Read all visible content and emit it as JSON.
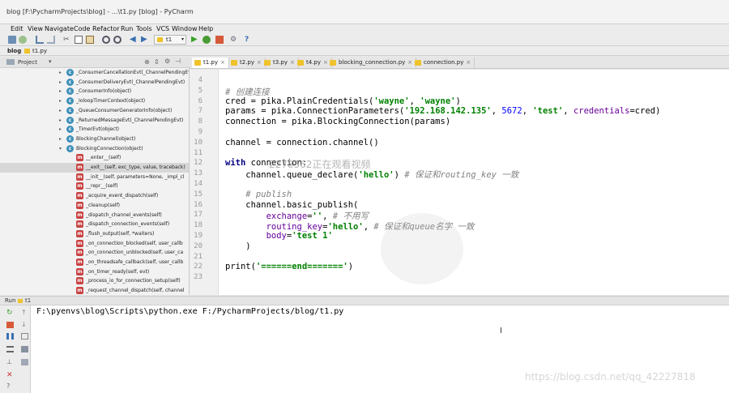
{
  "window": {
    "title": "blog [F:\\PycharmProjects\\blog] - ...\\t1.py [blog] - PyCharm"
  },
  "menu": [
    "Edit",
    "View",
    "Navigate",
    "Code",
    "Refactor",
    "Run",
    "Tools",
    "VCS",
    "Window",
    "Help"
  ],
  "toolbar": {
    "run_config": "t1"
  },
  "breadcrumb": [
    "blog",
    "t1.py"
  ],
  "project_panel": {
    "title": "Project",
    "items": [
      {
        "kind": "c",
        "label": "_ConsumerCancellationEvt(_ChannelPendingEvt)",
        "selected": false
      },
      {
        "kind": "c",
        "label": "_ConsumerDeliveryEvt(_ChannelPendingEvt)",
        "selected": false
      },
      {
        "kind": "c",
        "label": "_ConsumerInfo(object)",
        "selected": false
      },
      {
        "kind": "c",
        "label": "_IoloopTimerContext(object)",
        "selected": false
      },
      {
        "kind": "c",
        "label": "_QueueConsumerGeneratorInfo(object)",
        "selected": false
      },
      {
        "kind": "c",
        "label": "_ReturnedMessageEvt(_ChannelPendingEvt)",
        "selected": false
      },
      {
        "kind": "c",
        "label": "_TimerEvt(object)",
        "selected": false
      },
      {
        "kind": "c",
        "label": "BlockingChannel(object)",
        "selected": false
      },
      {
        "kind": "c",
        "label": "BlockingConnection(object)",
        "selected": false
      },
      {
        "kind": "m",
        "label": "__enter__(self)",
        "selected": false
      },
      {
        "kind": "m",
        "label": "__exit__(self, exc_type, value, traceback)",
        "selected": true
      },
      {
        "kind": "m",
        "label": "__init__(self, parameters=None, _impl_cl",
        "selected": false
      },
      {
        "kind": "m",
        "label": "__repr__(self)",
        "selected": false
      },
      {
        "kind": "m",
        "label": "_acquire_event_dispatch(self)",
        "selected": false
      },
      {
        "kind": "m",
        "label": "_cleanup(self)",
        "selected": false
      },
      {
        "kind": "m",
        "label": "_dispatch_channel_events(self)",
        "selected": false
      },
      {
        "kind": "m",
        "label": "_dispatch_connection_events(self)",
        "selected": false
      },
      {
        "kind": "m",
        "label": "_flush_output(self, *waiters)",
        "selected": false
      },
      {
        "kind": "m",
        "label": "_on_connection_blocked(self, user_callb",
        "selected": false
      },
      {
        "kind": "m",
        "label": "_on_connection_unblocked(self, user_ca",
        "selected": false
      },
      {
        "kind": "m",
        "label": "_on_threadsafe_callback(self, user_callb",
        "selected": false
      },
      {
        "kind": "m",
        "label": "_on_timer_ready(self, evt)",
        "selected": false
      },
      {
        "kind": "m",
        "label": "_process_io_for_connection_setup(self)",
        "selected": false
      },
      {
        "kind": "m",
        "label": "_request_channel_dispatch(self, channel",
        "selected": false
      }
    ]
  },
  "tabs": [
    {
      "label": "t1.py",
      "active": true
    },
    {
      "label": "t2.py",
      "active": false
    },
    {
      "label": "t3.py",
      "active": false
    },
    {
      "label": "t4.py",
      "active": false
    },
    {
      "label": "blocking_connection.py",
      "active": false
    },
    {
      "label": "connection.py",
      "active": false
    }
  ],
  "editor": {
    "line_numbers": [
      "4",
      "5",
      "6",
      "7",
      "8",
      "9",
      "10",
      "11",
      "12",
      "13",
      "14",
      "15",
      "16",
      "17",
      "18",
      "19",
      "20",
      "21",
      "22",
      "23"
    ],
    "lines": [
      [],
      [
        {
          "c": "cm",
          "t": "# 创建连接"
        }
      ],
      [
        {
          "c": "",
          "t": "cred = pika.PlainCredentials("
        },
        {
          "c": "str",
          "t": "'wayne'"
        },
        {
          "c": "",
          "t": ", "
        },
        {
          "c": "str",
          "t": "'wayne'"
        },
        {
          "c": "",
          "t": ")"
        }
      ],
      [
        {
          "c": "",
          "t": "params = pika.ConnectionParameters("
        },
        {
          "c": "str",
          "t": "'192.168.142.135'"
        },
        {
          "c": "",
          "t": ", "
        },
        {
          "c": "num",
          "t": "5672"
        },
        {
          "c": "",
          "t": ", "
        },
        {
          "c": "str",
          "t": "'test'"
        },
        {
          "c": "",
          "t": ", "
        },
        {
          "c": "kwa",
          "t": "credentials"
        },
        {
          "c": "",
          "t": "=cred)"
        }
      ],
      [
        {
          "c": "",
          "t": "connection = pika.BlockingConnection(params)"
        }
      ],
      [],
      [
        {
          "c": "",
          "t": "channel = connection.channel()"
        }
      ],
      [],
      [
        {
          "c": "kw",
          "t": "with"
        },
        {
          "c": "",
          "t": " connection:"
        }
      ],
      [
        {
          "c": "",
          "t": "    channel.queue_declare("
        },
        {
          "c": "str",
          "t": "'hello'"
        },
        {
          "c": "",
          "t": ") "
        },
        {
          "c": "cm",
          "t": "# 保证和routing_key 一致"
        }
      ],
      [],
      [
        {
          "c": "cm",
          "t": "    # publish"
        }
      ],
      [
        {
          "c": "",
          "t": "    channel.basic_publish("
        }
      ],
      [
        {
          "c": "kwa",
          "t": "        exchange"
        },
        {
          "c": "",
          "t": "="
        },
        {
          "c": "str",
          "t": "''"
        },
        {
          "c": "",
          "t": ", "
        },
        {
          "c": "cm",
          "t": "# 不用写"
        }
      ],
      [
        {
          "c": "kwa",
          "t": "        routing_key"
        },
        {
          "c": "",
          "t": "="
        },
        {
          "c": "str",
          "t": "'hello'"
        },
        {
          "c": "",
          "t": ", "
        },
        {
          "c": "cm",
          "t": "# 保证和queue名字 一致"
        }
      ],
      [
        {
          "c": "kwa",
          "t": "        body"
        },
        {
          "c": "",
          "t": "="
        },
        {
          "c": "str",
          "t": "'test 1'"
        }
      ],
      [
        {
          "c": "",
          "t": "    )"
        }
      ],
      [],
      [
        {
          "c": "",
          "t": "print("
        },
        {
          "c": "str",
          "t": "'======end======='"
        },
        {
          "c": "",
          "t": ")"
        }
      ],
      []
    ]
  },
  "overlay": {
    "watermark": "2278562正在观看视频"
  },
  "run_panel": {
    "title": "Run",
    "config": "t1",
    "output": "F:\\pyenvs\\blog\\Scripts\\python.exe F:/PycharmProjects/blog/t1.py"
  },
  "csdn_watermark": "https://blog.csdn.net/qq_42227818",
  "colors": {
    "accent_blue": "#3d8fb8",
    "method_red": "#c94242",
    "string_green": "#008000",
    "keyword_navy": "#000080"
  }
}
